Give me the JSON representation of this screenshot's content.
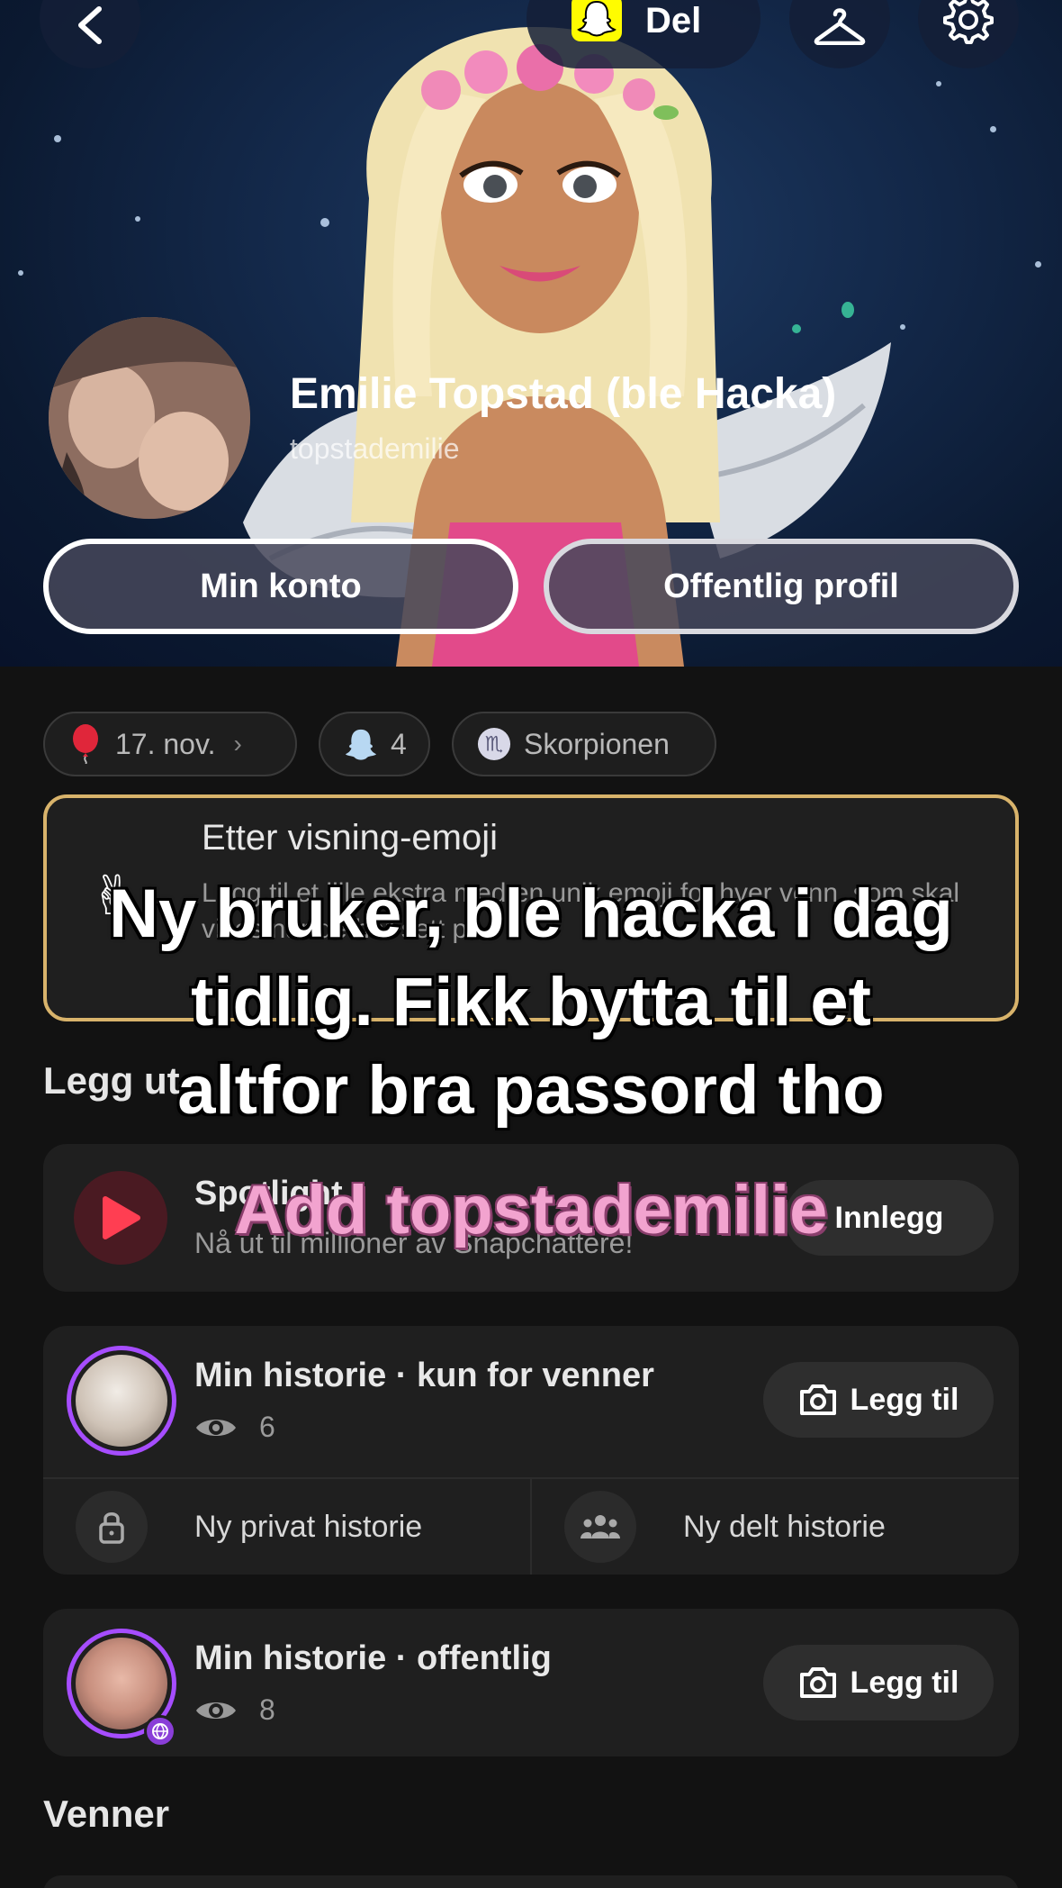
{
  "header": {
    "share_label": "Del",
    "name": "Emilie Topstad (ble Hacka)",
    "username": "topstademilie",
    "btn_account": "Min konto",
    "btn_public": "Offentlig profil"
  },
  "chips": {
    "birthday": "17. nov.",
    "ghost_count": "4",
    "zodiac": "Skorpionen"
  },
  "emoji_card": {
    "title": "Etter visning-emoji",
    "body": "Legg til et lille ekstra med en unik emoji for hver venn, som skal vises når de har sett på"
  },
  "sections": {
    "post": "Legg ut",
    "friends": "Venner"
  },
  "spotlight": {
    "title": "Spotlight",
    "sub": "Nå ut til millioner av Snapchattere!",
    "btn": "Innlegg"
  },
  "story_friends": {
    "title": "Min historie · kun for venner",
    "views": "6",
    "btn": "Legg til",
    "private": "Ny privat historie",
    "shared": "Ny delt historie"
  },
  "story_public": {
    "title": "Min historie · offentlig",
    "views": "8",
    "btn": "Legg til"
  },
  "overlay": {
    "line1": "Ny bruker, ble hacka i dag",
    "line2": "tidlig. Fikk bytta til et",
    "line3": "altfor bra passord tho",
    "pink": "Add topstademilie"
  }
}
